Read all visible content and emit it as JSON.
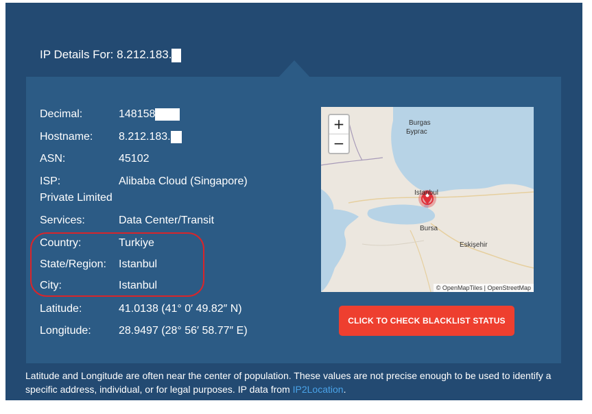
{
  "header": {
    "title": "IP Details For: 8.212.183."
  },
  "details": [
    {
      "key": "Decimal:",
      "value": "148158"
    },
    {
      "key": "Hostname:",
      "value": "8.212.183."
    },
    {
      "key": "ASN:",
      "value": "45102"
    },
    {
      "key": "ISP:",
      "value": "Alibaba Cloud (Singapore)"
    },
    {
      "key": "ISP_continued",
      "value": "Private Limited"
    },
    {
      "key": "Services:",
      "value": "Data Center/Transit"
    },
    {
      "key": "Country:",
      "value": "Turkiye"
    },
    {
      "key": "State/Region:",
      "value": "Istanbul"
    },
    {
      "key": "City:",
      "value": "Istanbul"
    },
    {
      "key": "Latitude:",
      "value": "41.0138 (41° 0′ 49.82″ N)"
    },
    {
      "key": "Longitude:",
      "value": "28.9497 (28° 56′ 58.77″ E)"
    }
  ],
  "map": {
    "zoom_in": "+",
    "zoom_out": "−",
    "attribution": "© OpenMapTiles | OpenStreetMap",
    "labels": {
      "burgas": "Burgas",
      "burgas_cyr": "Бургас",
      "istanbul": "Istanbul",
      "bursa": "Bursa",
      "eskisehir": "Eskişehir"
    },
    "colors": {
      "sea": "#b7d3e6",
      "land": "#ece7df",
      "marker": "#e0303a"
    }
  },
  "blacklist_button": "CLICK TO CHECK BLACKLIST STATUS",
  "footnote": {
    "text": "Latitude and Longitude are often near the center of population. These values are not precise enough to be used to identify a specific address, individual, or for legal purposes. IP data from ",
    "link": "IP2Location",
    "end": "."
  }
}
